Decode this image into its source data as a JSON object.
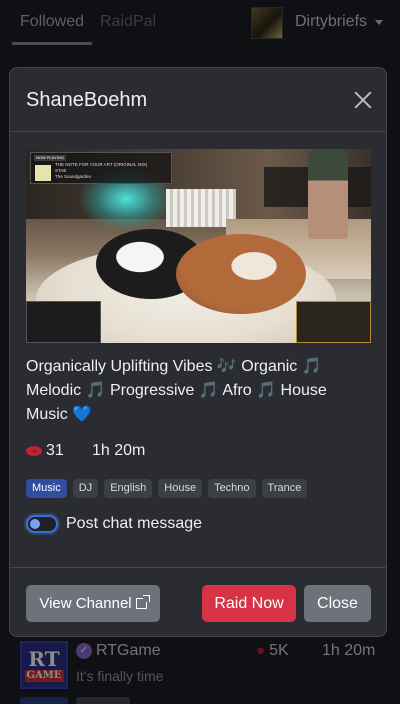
{
  "nav": {
    "tabs": [
      {
        "label": "Followed",
        "active": true
      },
      {
        "label": "RaidPal",
        "active": false
      }
    ],
    "user": {
      "name": "Dirtybriefs"
    }
  },
  "background_list": {
    "row": {
      "avatar_text_1": "RT",
      "avatar_text_2": "GAME",
      "name": "RTGame",
      "verified": true,
      "subtitle": "It's finally time",
      "viewers": "5K",
      "uptime": "1h 20m"
    }
  },
  "modal": {
    "title": "ShaneBoehm",
    "thumbnail": {
      "now_playing_tag": "NOW PLAYING",
      "track": "THE NOTE FOR YOUR ART (ORIGINAL MIX)",
      "artist": "STAE",
      "label": "The Soundgarden"
    },
    "description": "Organically Uplifting Vibes 🎶 Organic 🎵 Melodic 🎵 Progressive 🎵 Afro 🎵 House Music 💙",
    "viewers": "31",
    "uptime": "1h 20m",
    "tags": [
      "Music",
      "DJ",
      "English",
      "House",
      "Techno",
      "Trance"
    ],
    "post_chat": {
      "label": "Post chat message",
      "checked": false
    },
    "buttons": {
      "view_channel": "View Channel",
      "raid_now": "Raid Now",
      "close": "Close"
    }
  },
  "colors": {
    "accent_blue": "#3f6fd6",
    "danger": "#d63344",
    "secondary": "#6c737b",
    "eye_red": "#c0242f"
  }
}
